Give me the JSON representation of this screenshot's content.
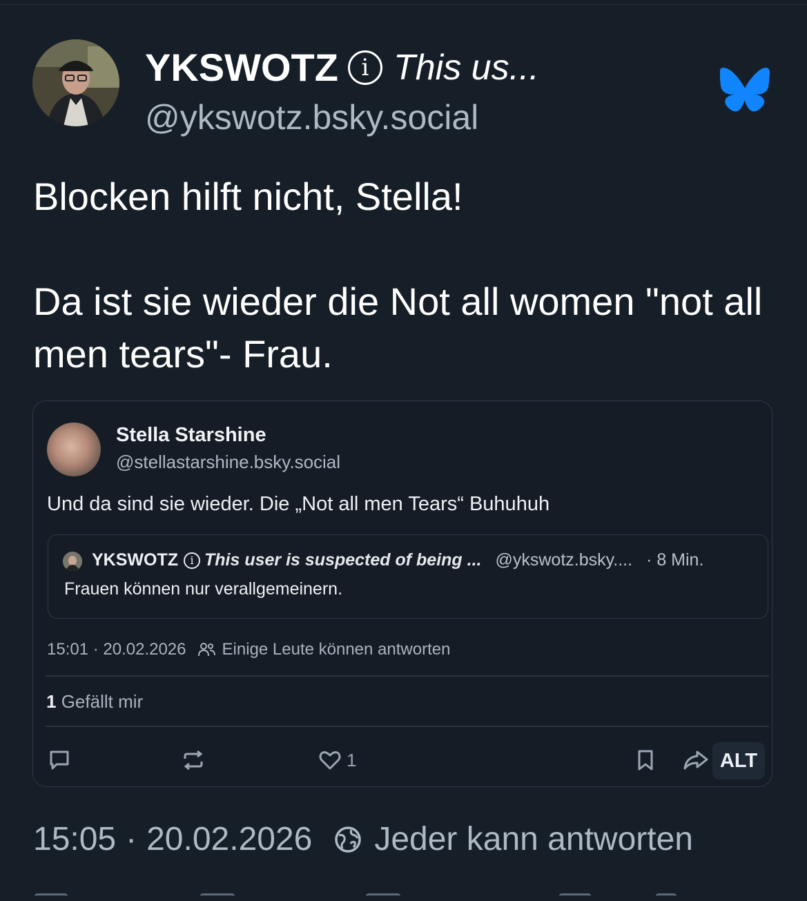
{
  "post": {
    "author_name": "YKSWOTZ",
    "author_info_glyph": "i",
    "author_warning": "This us...",
    "author_handle": "@ykswotz.bsky.social",
    "logo_icon": "bluesky-butterfly-icon",
    "text": "Blocken hilft nicht, Stella!\n\nDa ist sie wieder die Not all women \"not all men tears\"- Frau.",
    "time": "15:05",
    "date_sep": "·",
    "date": "20.02.2026",
    "reply_setting": "Jeder kann antworten",
    "accent_color": "#1185fe"
  },
  "quote": {
    "name": "Stella Starshine",
    "handle": "@stellastarshine.bsky.social",
    "text": "Und da sind sie wieder. Die „Not all men Tears“ Buhuhuh",
    "inner": {
      "name": "YKSWOTZ",
      "info_glyph": "i",
      "warning": "This user is suspected of being ...",
      "handle": "@ykswotz.bsky....",
      "time": "· 8 Min.",
      "text": "Frauen können nur verallgemeinern."
    },
    "meta_time": "15:01 · 20.02.2026",
    "reply_setting": "Einige Leute können antworten",
    "likes_count": "1",
    "likes_label": "Gefällt mir",
    "like_action_count": "1",
    "alt_label": "ALT"
  }
}
